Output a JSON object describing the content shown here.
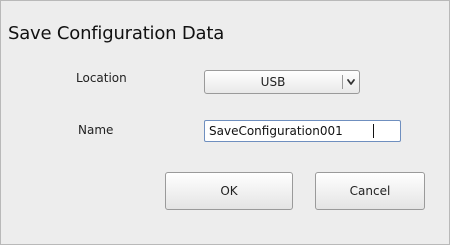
{
  "dialog": {
    "title": "Save Configuration Data",
    "location": {
      "label": "Location",
      "selected": "USB",
      "icon": "chevron-down-icon"
    },
    "name": {
      "label": "Name",
      "value": "SaveConfiguration001"
    },
    "buttons": {
      "ok": "OK",
      "cancel": "Cancel"
    }
  }
}
